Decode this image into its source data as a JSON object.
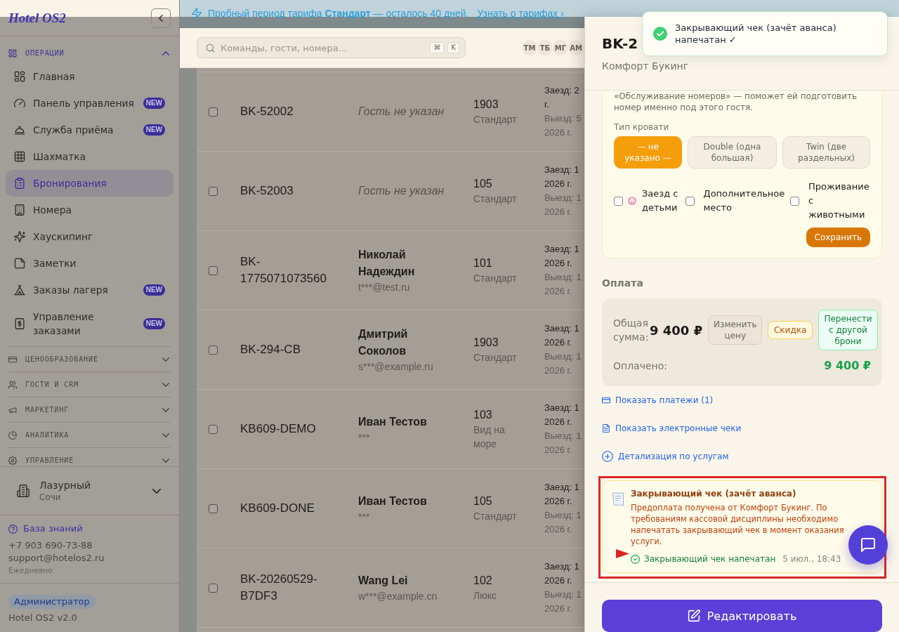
{
  "sidebar": {
    "logo": "Hotel OS2",
    "sections": [
      {
        "title": "ОПЕРАЦИИ",
        "expanded": true,
        "items": [
          {
            "label": "Главная",
            "selected": false
          },
          {
            "label": "Панель управления",
            "badge": "NEW",
            "selected": false
          },
          {
            "label": "Служба приёма",
            "badge": "NEW",
            "selected": false
          },
          {
            "label": "Шахматка",
            "selected": false
          },
          {
            "label": "Бронирования",
            "selected": true
          },
          {
            "label": "Номера",
            "selected": false
          },
          {
            "label": "Хаускипинг",
            "selected": false
          },
          {
            "label": "Заметки",
            "selected": false
          },
          {
            "label": "Заказы лагеря",
            "badge": "NEW",
            "selected": false
          },
          {
            "label": "Управление заказами",
            "badge": "NEW",
            "selected": false
          }
        ]
      },
      {
        "title": "ЦЕНООБРАЗОВАНИЕ",
        "expanded": false
      },
      {
        "title": "ГОСТИ И CRM",
        "expanded": false
      },
      {
        "title": "МАРКЕТИНГ",
        "expanded": false
      },
      {
        "title": "АНАЛИТИКА",
        "expanded": false
      },
      {
        "title": "УПРАВЛЕНИЕ",
        "expanded": false
      }
    ],
    "hotel": {
      "name": "Лазурный",
      "city": "Сочи"
    },
    "support": {
      "link": "База знаний",
      "phone": "+7 903 690-73-88",
      "email": "support@hotelos2.ru",
      "hours": "Ежедневно"
    },
    "role": "Администратор",
    "version": "Hotel OS2 v2.0"
  },
  "banner": {
    "text": "Пробный период тарифа **Стандарт** — осталось 40 дней.",
    "link": "Узнать о тарифах ›"
  },
  "header": {
    "search": {
      "placeholder": "Команды, гости, номера...",
      "keys": [
        "⌘",
        "K"
      ]
    },
    "avatars": [
      "ТМ",
      "ТБ",
      "МГ",
      "АМ"
    ]
  },
  "table": {
    "rows": [
      {
        "checked": false,
        "id": "BK-52002",
        "guest": {
          "kind": "missing",
          "name": "Гость не указан"
        },
        "room": "1903",
        "room_type": "Стандарт",
        "check_in": [
          "Заезд: 2",
          "г."
        ],
        "check_out": [
          "Выезд: 5",
          "2026 г."
        ]
      },
      {
        "checked": false,
        "id": "BK-52003",
        "guest": {
          "kind": "missing",
          "name": "Гость не указан"
        },
        "room": "105",
        "room_type": "Стандарт",
        "check_in": [
          "Заезд: 1",
          "2026 г."
        ],
        "check_out": [
          "Выезд: 1",
          "2026 г."
        ]
      },
      {
        "checked": false,
        "id": "BK-1775071073560",
        "guest": {
          "kind": "named",
          "name": "Николай Надеждин",
          "email": "t***@test.ru"
        },
        "room": "101",
        "room_type": "Стандарт",
        "check_in": [
          "Заезд: 1",
          "2026 г."
        ],
        "check_out": [
          "Выезд: 1",
          "2026 г."
        ]
      },
      {
        "checked": false,
        "id": "BK-294-CB",
        "guest": {
          "kind": "named",
          "name": "Дмитрий Соколов",
          "email": "s***@example.ru"
        },
        "room": "1903",
        "room_type": "Стандарт",
        "check_in": [
          "Заезд: 1",
          "2026 г."
        ],
        "check_out": [
          "Выезд: 1",
          "2026 г."
        ]
      },
      {
        "checked": false,
        "id": "KB609-DEMO",
        "guest": {
          "kind": "named",
          "name": "Иван Тестов",
          "email": "***"
        },
        "room": "103",
        "room_type": "Вид на море",
        "check_in": [
          "Заезд: 1",
          "2026 г."
        ],
        "check_out": [
          "Выезд: 1",
          "2026 г."
        ]
      },
      {
        "checked": false,
        "id": "KB609-DONE",
        "guest": {
          "kind": "named",
          "name": "Иван Тестов",
          "email": "***"
        },
        "room": "105",
        "room_type": "Стандарт",
        "check_in": [
          "Заезд: 1",
          "2026 г."
        ],
        "check_out": [
          "Выезд: 1",
          "2026 г."
        ]
      },
      {
        "checked": false,
        "id": "BK-20260529-B7DF3",
        "guest": {
          "kind": "named",
          "name": "Wang Lei",
          "email": "w***@example.cn"
        },
        "room": "102",
        "room_type": "Люкс",
        "check_in": [
          "Заезд: 1",
          "2026 г."
        ],
        "check_out": [
          "Выезд: 1",
          "2026 г."
        ]
      }
    ]
  },
  "drawer": {
    "title": "BK-2",
    "subtitle": "Комфорт Букинг",
    "preferences": {
      "note": "«Обслуживание номеров» — поможет ей подготовить номер именно под этого гостя.",
      "bed_label": "Тип кровати",
      "bed_types": [
        {
          "label": "— не указано —",
          "selected": true
        },
        {
          "label": "Double (одна большая)",
          "selected": false
        },
        {
          "label": "Twin (две раздельных)",
          "selected": false
        }
      ],
      "options": [
        {
          "label": "Заезд с детьми",
          "checked": false
        },
        {
          "label": "Дополнительное место",
          "checked": false
        },
        {
          "label": "Проживание с животными",
          "checked": false
        }
      ],
      "save": "Сохранить"
    },
    "payment": {
      "heading": "Оплата",
      "total_label": "Общая сумма:",
      "total": "9 400 ₽",
      "actions": [
        {
          "label": "Изменить цену",
          "kind": "neutral"
        },
        {
          "label": "Скидка",
          "kind": "warning"
        },
        {
          "label": "Перенести с другой брони",
          "kind": "success"
        }
      ],
      "paid_label": "Оплачено:",
      "paid": "9 400 ₽"
    },
    "links": [
      "Показать платежи (1)",
      "Показать электронные чеки",
      "Детализация по услугам"
    ],
    "receipt_notice": {
      "title": "Закрывающий чек (зачёт аванса)",
      "text": "Предоплата получена от Комфорт Букинг. По требованиям кассовой дисциплины необходимо напечатать закрывающий чек в момент оказания услуги.",
      "status": "Закрывающий чек напечатан",
      "time": "5 июл., 18:43",
      "highlighted": true
    },
    "edit_button": "Редактировать"
  },
  "toast": {
    "kind": "success",
    "text": "Закрывающий чек (зачёт аванса) напечатан ✓"
  }
}
